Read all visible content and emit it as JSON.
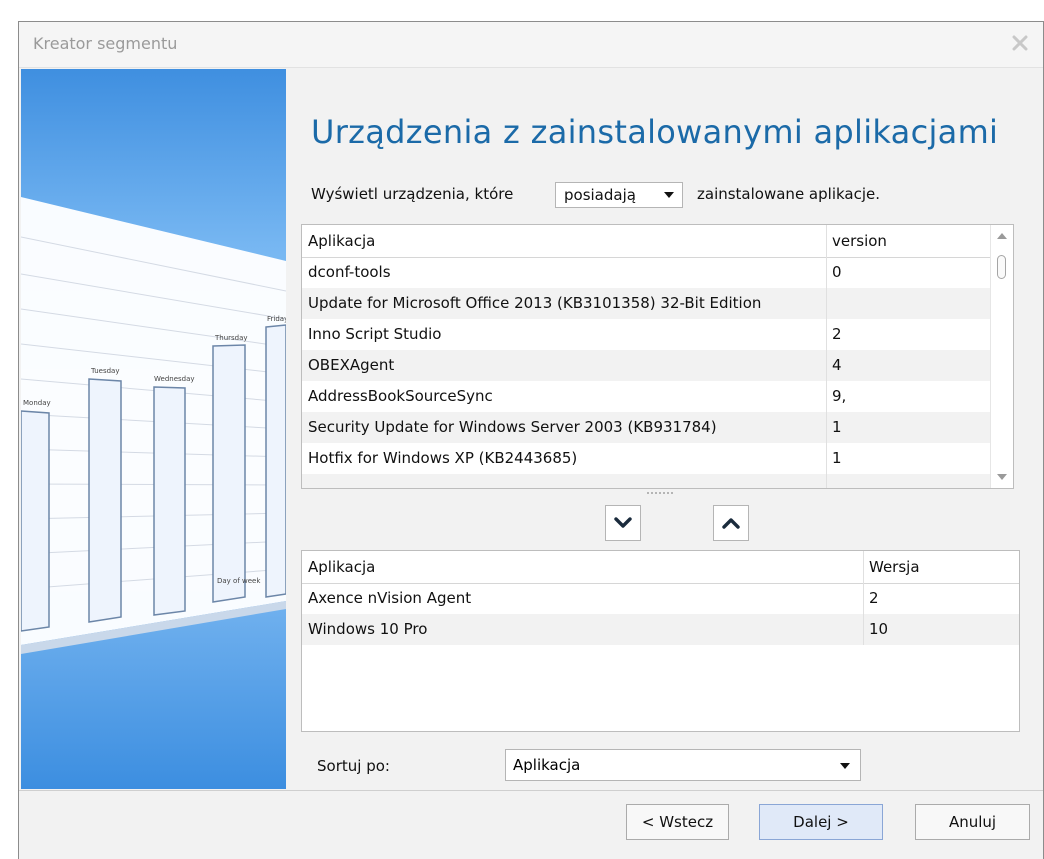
{
  "window": {
    "title": "Kreator segmentu"
  },
  "heading": "Urządzenia z zainstalowanymi aplikacjami",
  "filter": {
    "prefix": "Wyświetl urządzenia, które",
    "mode_selected": "posiadają",
    "suffix": "zainstalowane aplikacje."
  },
  "available_grid": {
    "columns": [
      "Aplikacja",
      "version"
    ],
    "rows": [
      [
        "dconf-tools",
        "0"
      ],
      [
        "Update for Microsoft Office 2013 (KB3101358) 32-Bit Edition",
        ""
      ],
      [
        "Inno Script Studio",
        "2"
      ],
      [
        "OBEXAgent",
        "4"
      ],
      [
        "AddressBookSourceSync",
        "9,"
      ],
      [
        "Security Update for Windows Server 2003 (KB931784)",
        "1"
      ],
      [
        "Hotfix for Windows XP (KB2443685)",
        "1"
      ]
    ]
  },
  "selected_grid": {
    "columns": [
      "Aplikacja",
      "Wersja"
    ],
    "rows": [
      [
        "Axence nVision Agent",
        "2"
      ],
      [
        "Windows 10 Pro",
        "10"
      ]
    ]
  },
  "move_buttons": {
    "down_icon": "chevron-down-icon",
    "up_icon": "chevron-up-icon"
  },
  "sort": {
    "label": "Sortuj po:",
    "selected": "Aplikacja"
  },
  "sidebar_chart": {
    "labels": [
      "Monday",
      "Tuesday",
      "Wednesday",
      "Thursday",
      "Friday"
    ],
    "caption": "Day of week"
  },
  "footer": {
    "back_label": "< Wstecz",
    "next_label": "Dalej >",
    "cancel_label": "Anuluj"
  },
  "colors": {
    "heading": "#1b6aa8",
    "sidebar_gradient_top": "#3f8fe0",
    "sidebar_gradient_bottom": "#3c8ee0",
    "primary_button": "#e0e9f8"
  }
}
